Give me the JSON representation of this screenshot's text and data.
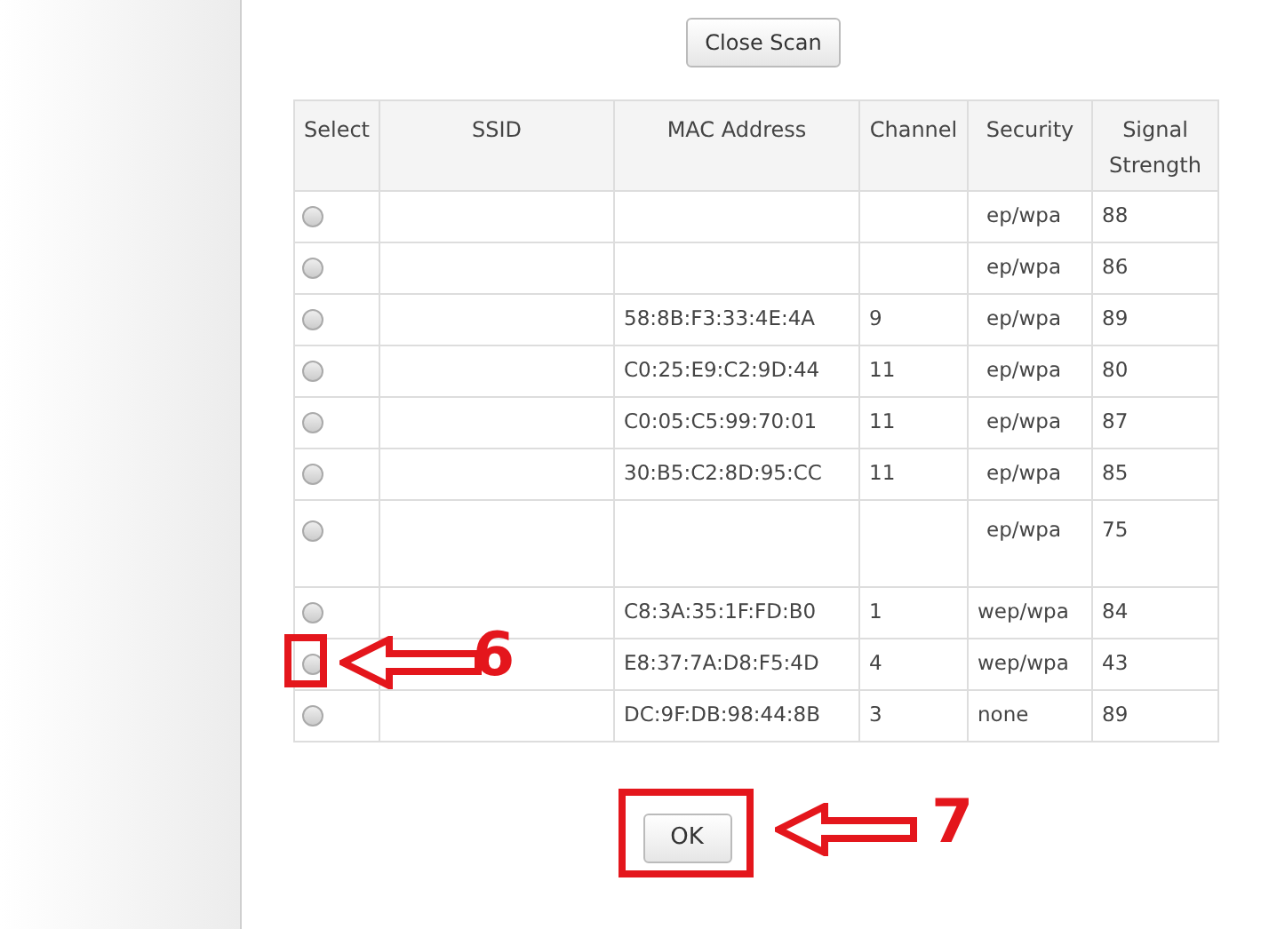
{
  "close_scan_button": "Close Scan",
  "table": {
    "columns": [
      "Select",
      "SSID",
      "MAC Address",
      "Channel",
      "Security",
      "Signal Strength"
    ],
    "rows": [
      {
        "selected": false,
        "mac": "",
        "channel": "",
        "security": "ep/wpa",
        "signal": "88"
      },
      {
        "selected": false,
        "mac": "",
        "channel": "",
        "security": "ep/wpa",
        "signal": "86"
      },
      {
        "selected": false,
        "mac": "58:8B:F3:33:4E:4A",
        "channel": "9",
        "security": "ep/wpa",
        "signal": "89"
      },
      {
        "selected": false,
        "mac": "C0:25:E9:C2:9D:44",
        "channel": "11",
        "security": "ep/wpa",
        "signal": "80"
      },
      {
        "selected": false,
        "mac": "C0:05:C5:99:70:01",
        "channel": "11",
        "security": "ep/wpa",
        "signal": "87"
      },
      {
        "selected": false,
        "mac": "30:B5:C2:8D:95:CC",
        "channel": "11",
        "security": "ep/wpa",
        "signal": "85"
      },
      {
        "selected": false,
        "tall": true,
        "mac": "",
        "channel": "",
        "security": "ep/wpa",
        "signal": "75"
      },
      {
        "selected": false,
        "mac": "C8:3A:35:1F:FD:B0",
        "channel": "1",
        "security": "wep/wpa",
        "signal": "84"
      },
      {
        "selected": false,
        "mac": "E8:37:7A:D8:F5:4D",
        "channel": "4",
        "security": "wep/wpa",
        "signal": "43"
      },
      {
        "selected": false,
        "mac": "DC:9F:DB:98:44:8B",
        "channel": "3",
        "security": "none",
        "signal": "89"
      }
    ]
  },
  "buttons": [
    "OK"
  ],
  "annotations": [
    {
      "label": "6"
    },
    {
      "label": "7"
    }
  ]
}
